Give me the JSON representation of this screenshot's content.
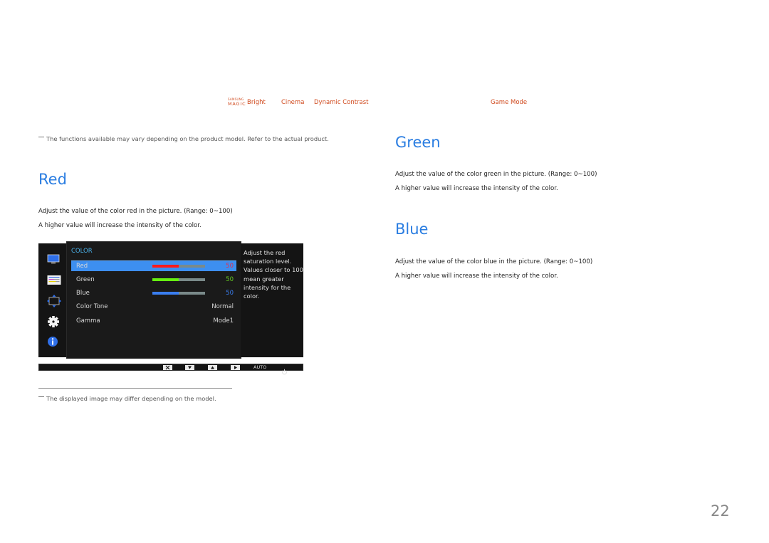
{
  "top_nav": {
    "magic_brand_top": "SAMSUNG",
    "magic_brand_bottom": "MAGIC",
    "items": [
      "Bright",
      "Cinema",
      "Dynamic Contrast",
      "Game Mode"
    ],
    "accent_color": "#d04a1e"
  },
  "notes": {
    "functions_note": "The functions available may vary depending on the product model. Refer to the actual product.",
    "image_note": "The displayed image may differ depending on the model."
  },
  "sections": {
    "red": {
      "title": "Red",
      "line1": "Adjust the value of the color red in the picture. (Range: 0~100)",
      "line2": "A higher value will increase the intensity of the color."
    },
    "green": {
      "title": "Green",
      "line1": "Adjust the value of the color green in the picture. (Range: 0~100)",
      "line2": "A higher value will increase the intensity of the color."
    },
    "blue": {
      "title": "Blue",
      "line1": "Adjust the value of the color blue in the picture. (Range: 0~100)",
      "line2": "A higher value will increase the intensity of the color."
    }
  },
  "osd": {
    "menu_title": "COLOR",
    "side_icons": [
      "picture-icon",
      "onscreen-display-icon",
      "position-icon",
      "settings-gear-icon",
      "information-icon"
    ],
    "rows": [
      {
        "label": "Red",
        "value": "50",
        "level": 0.5,
        "bar_color": "#ff1a1a",
        "value_color": "#e03050",
        "selected": true
      },
      {
        "label": "Green",
        "value": "50",
        "level": 0.5,
        "bar_color": "#66ee11",
        "value_color": "#66cc22",
        "selected": false
      },
      {
        "label": "Blue",
        "value": "50",
        "level": 0.5,
        "bar_color": "#3a7ef0",
        "value_color": "#3a7ef0",
        "selected": false
      },
      {
        "label": "Color Tone",
        "value": "Normal"
      },
      {
        "label": "Gamma",
        "value": "Mode1"
      }
    ],
    "help_text": "Adjust the red saturation level. Values closer to 100 mean greater intensity for the color.",
    "bottom_buttons": {
      "close": "close-icon",
      "down": "down-arrow-icon",
      "up": "up-arrow-icon",
      "right": "right-arrow-icon",
      "auto_label": "AUTO",
      "power": "power-icon"
    }
  },
  "page_number": "22"
}
